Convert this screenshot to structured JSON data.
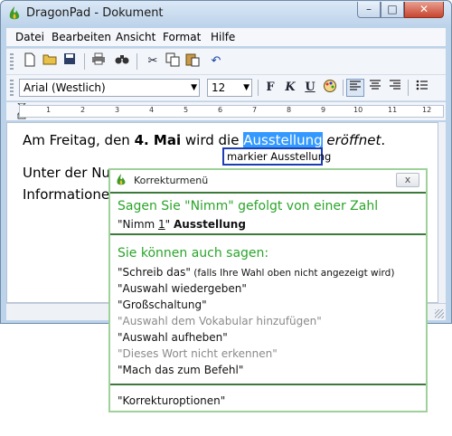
{
  "window": {
    "title": "DragonPad - Dokument",
    "controls": {
      "minimize": "–",
      "maximize": "□",
      "close": "✕"
    }
  },
  "menu": [
    "Datei",
    "Bearbeiten",
    "Ansicht",
    "Format",
    "Hilfe"
  ],
  "toolbar": {
    "icons": [
      "new-document-icon",
      "open-folder-icon",
      "save-icon",
      "print-icon",
      "find-icon",
      "cut-icon",
      "copy-icon",
      "paste-icon",
      "undo-icon"
    ]
  },
  "format_toolbar": {
    "font": "Arial (Westlich)",
    "size": "12",
    "bold": "F",
    "italic": "K",
    "underline": "U"
  },
  "ruler": {
    "numbers": [
      "1",
      "2",
      "3",
      "4",
      "5",
      "6",
      "7",
      "8",
      "9",
      "10",
      "11",
      "12"
    ]
  },
  "document": {
    "line1": {
      "a": "Am Freitag, den ",
      "b": "4. Mai",
      "c": " wird die ",
      "sel": "Ausstellung",
      "d": " ",
      "e": "eröffnet",
      "f": "."
    },
    "line2": "Unter der Num",
    "line3": "Informationen"
  },
  "tooltip": "markier Ausstellung",
  "correction_menu": {
    "title": "Korrekturmenü",
    "close": "x",
    "heading1": "Sagen Sie \"Nimm\" gefolgt von einer Zahl",
    "choice": {
      "prefix": "\"Nimm ",
      "num": "1",
      "suffix": "\" ",
      "word": "Ausstellung"
    },
    "heading2": "Sie können auch sagen:",
    "commands": [
      {
        "text": "\"Schreib das\"",
        "note": "  (falls Ihre Wahl oben nicht angezeigt wird)",
        "gray": false
      },
      {
        "text": "\"Auswahl wiedergeben\"",
        "note": "",
        "gray": false
      },
      {
        "text": "\"Großschaltung\"",
        "note": "",
        "gray": false
      },
      {
        "text": "\"Auswahl dem Vokabular hinzufügen\"",
        "note": "",
        "gray": true
      },
      {
        "text": "\"Auswahl aufheben\"",
        "note": "",
        "gray": false
      },
      {
        "text": "\"Dieses Wort nicht erkennen\"",
        "note": "",
        "gray": true
      },
      {
        "text": "\"Mach das zum Befehl\"",
        "note": "",
        "gray": false
      }
    ],
    "footer": "\"Korrekturoptionen\""
  },
  "colors": {
    "accent_green": "#2aa52a",
    "selection": "#3399ff",
    "tooltip_border": "#1b3db5"
  }
}
